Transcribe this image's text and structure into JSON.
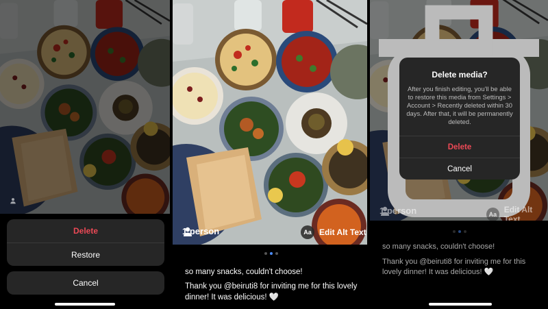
{
  "panel1": {
    "sheet_delete": "Delete",
    "sheet_restore": "Restore",
    "sheet_cancel": "Cancel"
  },
  "panel2": {
    "tag_label": "1 person",
    "alt_text_badge": "Aa",
    "alt_text_label": "Edit Alt Text",
    "caption_line1": "so many snacks, couldn't choose!",
    "caption_line2": "Thank you @beiruti8 for inviting me for this lovely dinner! It was delicious! 🤍"
  },
  "panel3": {
    "tag_label": "1 person",
    "alt_text_badge": "Aa",
    "alt_text_label": "Edit Alt Text",
    "caption_line1": "so many snacks, couldn't choose!",
    "caption_line2": "Thank you @beiruti8 for inviting me for this lovely dinner! It was delicious! 🤍",
    "dialog_title": "Delete media?",
    "dialog_message": "After you finish editing, you'll be able to restore this media from Settings > Account > Recently deleted within 30 days. After that, it will be permanently deleted.",
    "dialog_delete": "Delete",
    "dialog_cancel": "Cancel"
  },
  "colors": {
    "destructive": "#ed4956",
    "sheet_bg": "#262626",
    "active_dot": "#4c8dff"
  },
  "icons": [
    "person-icon",
    "trash-icon"
  ]
}
